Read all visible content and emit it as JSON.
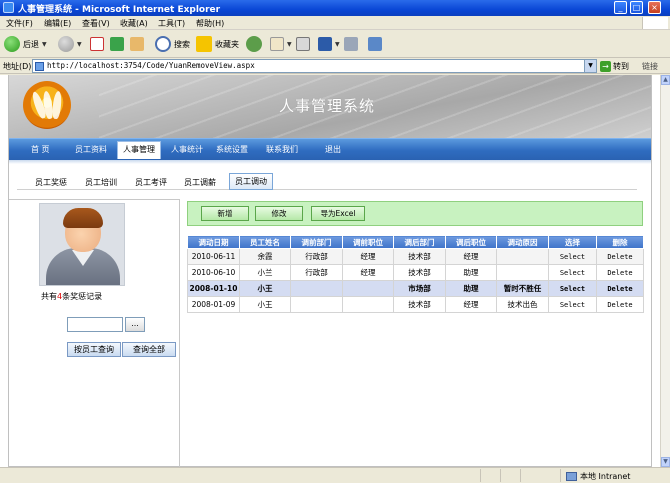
{
  "window": {
    "title": "人事管理系统 - Microsoft Internet Explorer",
    "controls": [
      "_",
      "□",
      "×"
    ]
  },
  "menu": [
    "文件(F)",
    "编辑(E)",
    "查看(V)",
    "收藏(A)",
    "工具(T)",
    "帮助(H)"
  ],
  "toolbar": {
    "back": "后退",
    "search": "搜索",
    "favorites": "收藏夹"
  },
  "address": {
    "label": "地址(D)",
    "url": "http://localhost:3754/Code/YuanRemoveView.aspx",
    "go": "转到",
    "links": "链接"
  },
  "banner": {
    "title": "人事管理系统"
  },
  "mainnav": [
    "首 页",
    "员工资料",
    "人事管理",
    "人事统计",
    "系统设置",
    "联系我们",
    "退出"
  ],
  "mainnav_active": "人事管理",
  "subnav": [
    "员工奖惩",
    "员工培训",
    "员工考评",
    "员工调薪",
    "员工调动"
  ],
  "subnav_active": "员工调动",
  "left": {
    "count_prefix": "共有",
    "count": "4",
    "count_suffix": "条奖惩记录",
    "search_value": "",
    "dots_label": "...",
    "btn_by_employee": "按员工查询",
    "btn_query_all": "查询全部"
  },
  "actions": {
    "add": "新增",
    "edit": "修改",
    "export": "导为Excel"
  },
  "table": {
    "headers": [
      "调动日期",
      "员工姓名",
      "调前部门",
      "调前职位",
      "调后部门",
      "调后职位",
      "调动原因",
      "选择",
      "删除"
    ],
    "rows": [
      [
        "2010-06-11",
        "余霞",
        "行政部",
        "经理",
        "技术部",
        "经理",
        "",
        "Select",
        "Delete"
      ],
      [
        "2010-06-10",
        "小兰",
        "行政部",
        "经理",
        "技术部",
        "助理",
        "",
        "Select",
        "Delete"
      ],
      [
        "2008-01-10",
        "小王",
        "",
        "",
        "市场部",
        "助理",
        "暂时不胜任",
        "Select",
        "Delete"
      ],
      [
        "2008-01-09",
        "小王",
        "",
        "",
        "技术部",
        "经理",
        "技术出色",
        "Select",
        "Delete"
      ]
    ],
    "selected_row": 2
  },
  "status": {
    "zone": "本地 Intranet"
  },
  "colors": {
    "nav_blue": "#2f6cc0",
    "header_blue": "#3e73c9",
    "action_green": "#c8f2c0",
    "xp_title": "#0a47d6"
  }
}
